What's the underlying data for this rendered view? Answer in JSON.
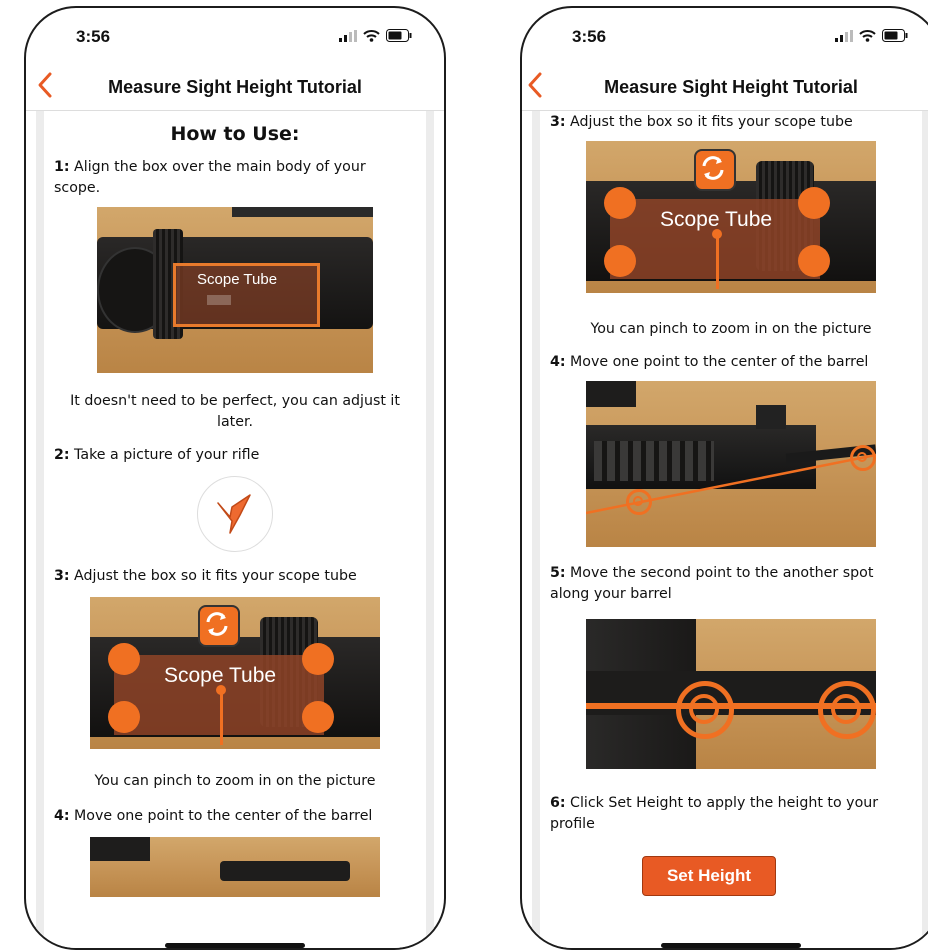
{
  "status": {
    "time": "3:56"
  },
  "nav": {
    "title": "Measure Sight Height Tutorial"
  },
  "tutorial": {
    "heading": "How to Use:",
    "step1_num": "1:",
    "step1_text": " Align the box over the main body of your scope.",
    "img_label_small": "Scope Tube",
    "caption1": "It doesn't need to be perfect, you can adjust it later.",
    "step2_num": "2:",
    "step2_text": " Take a picture of your rifle",
    "step3_num": "3:",
    "step3_text": " Adjust the box so it fits your scope tube",
    "img_label_large": "Scope Tube",
    "caption3": "You can pinch to zoom in on the picture",
    "step4_num": "4:",
    "step4_text": " Move one point to the center of the barrel",
    "step5_num": "5:",
    "step5_text": " Move the second point to the another spot along your barrel",
    "step6_num": "6:",
    "step6_text": " Click Set Height to apply the height to your profile"
  },
  "actions": {
    "set_height": "Set Height"
  },
  "colors": {
    "accent": "#f07022",
    "button": "#e85a24"
  },
  "icons": [
    "back-chevron-icon",
    "signal-icon",
    "wifi-icon",
    "battery-icon",
    "camera-bird-icon",
    "swap-icon"
  ]
}
